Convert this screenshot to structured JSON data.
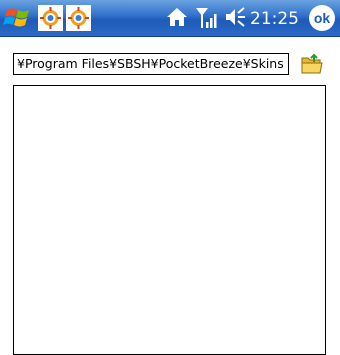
{
  "status_bar": {
    "start_icon": "windows-flag-icon",
    "tray_apps": [
      "gear-app-icon",
      "gear-app-icon"
    ],
    "home_icon": "home-icon",
    "signal_icon": "signal-strength-icon",
    "volume_icon": "speaker-icon",
    "clock": "21:25",
    "ok_label": "ok"
  },
  "path_field": {
    "value": "¥Program Files¥SBSH¥PocketBreeze¥Skins",
    "browse_icon": "folder-icon"
  },
  "file_list": {
    "items": []
  },
  "colors": {
    "titlebar": "#2e6fcb",
    "background": "#ffffff"
  }
}
